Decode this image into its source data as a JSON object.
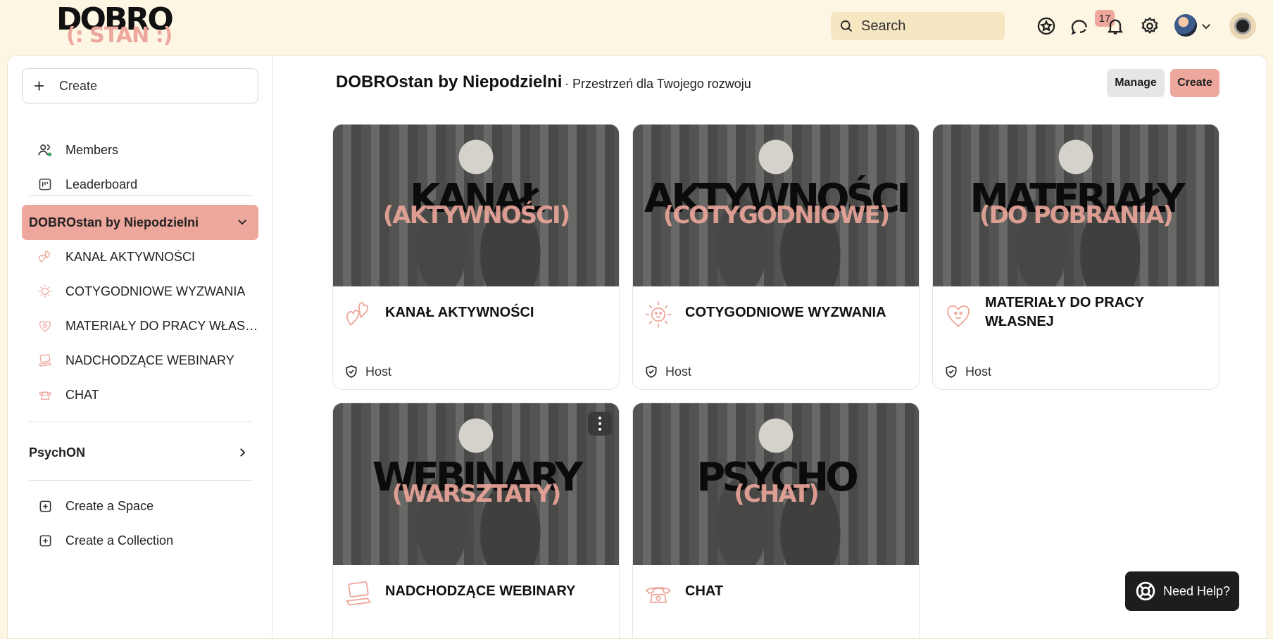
{
  "brand": {
    "logo_main": "DOBRO",
    "logo_sub": "(: STAN :)",
    "accent": "#eda79c",
    "bg": "#fdf6e3"
  },
  "header": {
    "search_placeholder": "Search",
    "notification_count": "17",
    "icons": [
      "star-badge-icon",
      "chat-bubbles-icon",
      "bell-icon",
      "gear-icon",
      "avatar",
      "chevron-down-icon",
      "workspace-icon"
    ]
  },
  "sidebar": {
    "create_label": "Create",
    "top_items": [
      {
        "label": "Members",
        "icon": "members-icon"
      },
      {
        "label": "Leaderboard",
        "icon": "leaderboard-icon"
      }
    ],
    "space_group": {
      "label": "DOBROstan by Niepodzielni",
      "items": [
        {
          "label": "KANAŁ AKTYWNOŚCI",
          "icon": "hearts-doodle-icon"
        },
        {
          "label": "COTYGODNIOWE WYZWANIA",
          "icon": "sun-doodle-icon"
        },
        {
          "label": "MATERIAŁY DO PRACY WŁASNEJ",
          "icon": "heart-face-doodle-icon"
        },
        {
          "label": "NADCHODZĄCE WEBINARY",
          "icon": "laptop-doodle-icon"
        },
        {
          "label": "CHAT",
          "icon": "phone-doodle-icon"
        }
      ]
    },
    "collapsed_group": {
      "label": "PsychON"
    },
    "bottom_items": [
      {
        "label": "Create a Space",
        "icon": "plus-square-icon"
      },
      {
        "label": "Create a Collection",
        "icon": "plus-square-icon"
      }
    ]
  },
  "main": {
    "title": "DOBROstan by Niepodzielni",
    "subtitle": "· Przestrzeń dla Twojego rozwoju",
    "manage_label": "Manage",
    "create_label": "Create",
    "cards": [
      {
        "cover_title": "KANAŁ",
        "cover_sub": "(AKTYWNOŚCI)",
        "title": "KANAŁ AKTYWNOŚCI",
        "role": "Host",
        "icon": "hearts-doodle-icon"
      },
      {
        "cover_title": "AKTYWNOŚCI",
        "cover_sub": "(COTYGODNIOWE)",
        "title": "COTYGODNIOWE WYZWANIA",
        "role": "Host",
        "icon": "sun-doodle-icon"
      },
      {
        "cover_title": "MATERIAŁY",
        "cover_sub": "(DO POBRANIA)",
        "title": "MATERIAŁY DO PRACY WŁASNEJ",
        "role": "Host",
        "icon": "heart-face-doodle-icon"
      },
      {
        "cover_title": "WEBINARY",
        "cover_sub": "(WARSZTATY)",
        "title": "NADCHODZĄCE WEBINARY",
        "role": "",
        "icon": "laptop-doodle-icon"
      },
      {
        "cover_title": "PSYCHO",
        "cover_sub": "(CHAT)",
        "title": "CHAT",
        "role": "",
        "icon": "phone-doodle-icon"
      }
    ]
  },
  "help": {
    "label": "Need Help?"
  }
}
